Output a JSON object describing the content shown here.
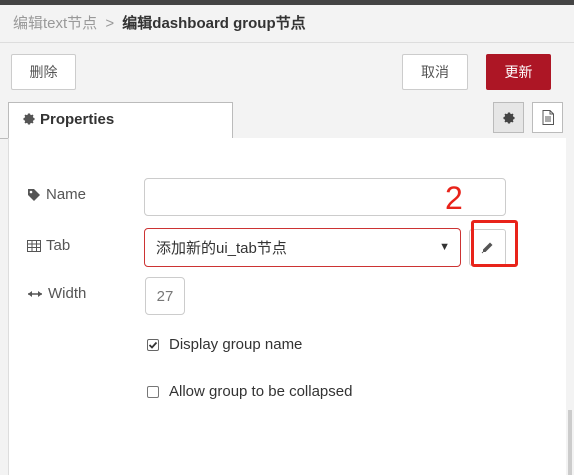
{
  "breadcrumb": {
    "previous": "编辑text节点",
    "separator": ">",
    "current": "编辑dashboard group节点"
  },
  "actions": {
    "delete_label": "删除",
    "cancel_label": "取消",
    "update_label": "更新",
    "update_color": "#ad1625"
  },
  "tabs": {
    "properties_label": "Properties",
    "settings_icon": "gear-icon",
    "description_icon": "document-icon"
  },
  "form": {
    "name": {
      "label": "Name",
      "icon": "tag-icon",
      "value": ""
    },
    "tab": {
      "label": "Tab",
      "icon": "table-icon",
      "selected": "添加新的ui_tab节点",
      "edit_icon": "pencil-icon"
    },
    "width": {
      "label": "Width",
      "icon": "arrows-h-icon",
      "value": "27"
    },
    "display_group_name": {
      "label": "Display group name",
      "checked": true
    },
    "allow_collapse": {
      "label": "Allow group to be collapsed",
      "checked": false
    }
  },
  "annotation": {
    "number": "2",
    "color": "#e8231a"
  }
}
